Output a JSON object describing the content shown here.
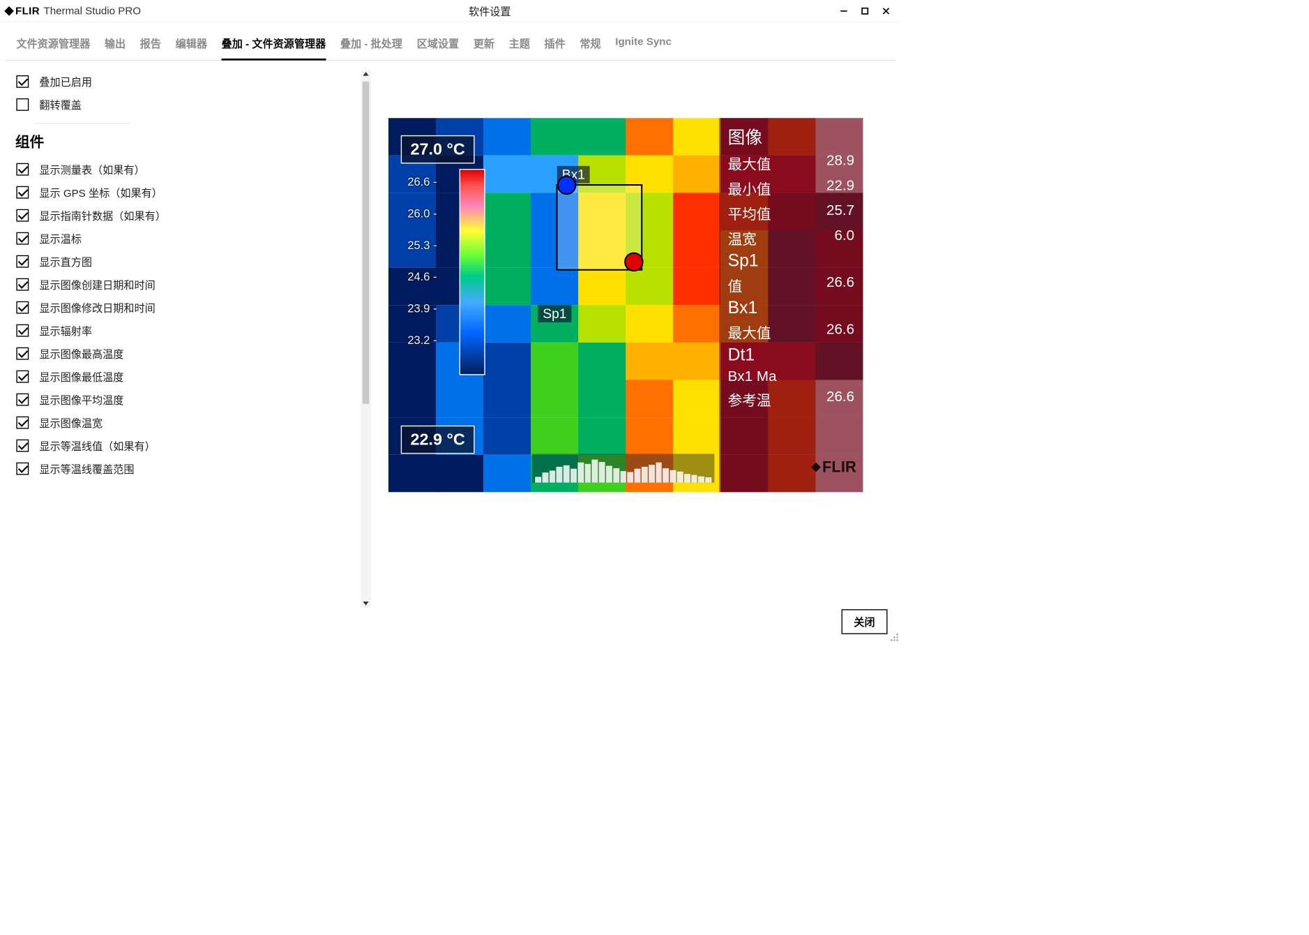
{
  "title": {
    "brand": "FLIR",
    "product": "Thermal Studio PRO",
    "dialog": "软件设置"
  },
  "tabs": [
    {
      "label": "文件资源管理器",
      "active": false
    },
    {
      "label": "输出",
      "active": false
    },
    {
      "label": "报告",
      "active": false
    },
    {
      "label": "编辑器",
      "active": false
    },
    {
      "label": "叠加 - 文件资源管理器",
      "active": true
    },
    {
      "label": "叠加 - 批处理",
      "active": false
    },
    {
      "label": "区域设置",
      "active": false
    },
    {
      "label": "更新",
      "active": false
    },
    {
      "label": "主题",
      "active": false
    },
    {
      "label": "插件",
      "active": false
    },
    {
      "label": "常规",
      "active": false
    },
    {
      "label": "Ignite Sync",
      "active": false
    }
  ],
  "settings_top": [
    {
      "label": "叠加已启用",
      "checked": true
    },
    {
      "label": "翻转覆盖",
      "checked": false
    }
  ],
  "section_heading": "组件",
  "settings_components": [
    {
      "label": "显示测量表（如果有）",
      "checked": true
    },
    {
      "label": "显示 GPS 坐标（如果有）",
      "checked": true
    },
    {
      "label": "显示指南针数据（如果有）",
      "checked": true
    },
    {
      "label": "显示温标",
      "checked": true
    },
    {
      "label": "显示直方图",
      "checked": true
    },
    {
      "label": "显示图像创建日期和时间",
      "checked": true
    },
    {
      "label": "显示图像修改日期和时间",
      "checked": true
    },
    {
      "label": "显示辐射率",
      "checked": true
    },
    {
      "label": "显示图像最高温度",
      "checked": true
    },
    {
      "label": "显示图像最低温度",
      "checked": true
    },
    {
      "label": "显示图像平均温度",
      "checked": true
    },
    {
      "label": "显示图像温宽",
      "checked": true
    },
    {
      "label": "显示等温线值（如果有）",
      "checked": true
    },
    {
      "label": "显示等温线覆盖范围",
      "checked": true
    }
  ],
  "preview": {
    "temp_top": "27.0 °C",
    "temp_bot": "22.9 °C",
    "ticks": [
      "26.6 -",
      "26.0 -",
      "25.3 -",
      "24.6 -",
      "23.9 -",
      "23.2 -"
    ],
    "bx_label": "Bx1",
    "sp_label": "Sp1",
    "stats": {
      "heading": "图像",
      "image_rows": [
        {
          "k": "最大值",
          "v": "28.9"
        },
        {
          "k": "最小值",
          "v": "22.9"
        },
        {
          "k": "平均值",
          "v": "25.7"
        },
        {
          "k": "温宽",
          "v": "6.0"
        }
      ],
      "sp_heading": "Sp1",
      "sp_rows": [
        {
          "k": "值",
          "v": "26.6"
        }
      ],
      "bx_heading": "Bx1",
      "bx_rows": [
        {
          "k": "最大值",
          "v": "26.6"
        }
      ],
      "dt_heading": "Dt1",
      "dt_rows": [
        {
          "k": "Bx1 Ma",
          "v": ""
        },
        {
          "k": "参考温",
          "v": "26.6"
        }
      ]
    },
    "overlay_brand": "FLIR",
    "histo_heights": [
      20,
      35,
      42,
      55,
      60,
      48,
      70,
      65,
      80,
      72,
      58,
      50,
      40,
      36,
      48,
      55,
      62,
      70,
      50,
      44,
      38,
      30,
      26,
      22,
      18
    ]
  },
  "footer": {
    "close": "关闭"
  }
}
